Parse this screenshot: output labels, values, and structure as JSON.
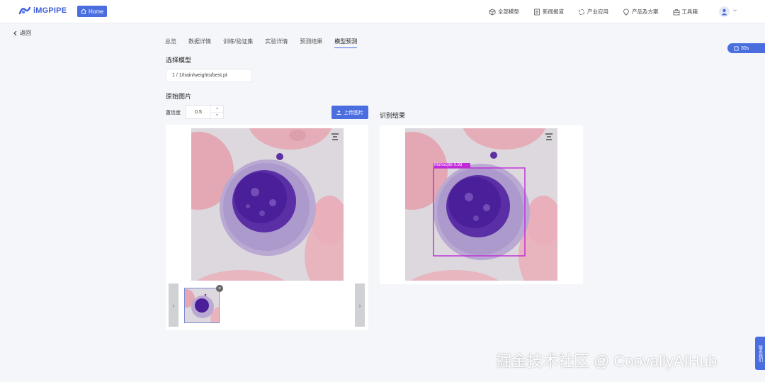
{
  "header": {
    "logo_text": "iMGPIPE",
    "home_label": "Home",
    "nav": [
      {
        "label": "全部模型",
        "icon": "cube-icon"
      },
      {
        "label": "新闻报道",
        "icon": "document-icon"
      },
      {
        "label": "产业应用",
        "icon": "cycle-icon"
      },
      {
        "label": "产品及方案",
        "icon": "bulb-icon"
      },
      {
        "label": "工具箱",
        "icon": "toolbox-icon"
      }
    ]
  },
  "back_label": "返回",
  "tabs": [
    "总览",
    "数据详情",
    "训练/验证集",
    "实验详情",
    "预测结果",
    "模型预测"
  ],
  "active_tab_index": 5,
  "timer_label": "30s",
  "model": {
    "section_label": "选择模型",
    "selected": "1 / 1/train/weights/best.pt"
  },
  "original": {
    "section_label": "原始图片",
    "confidence_label": "置信度",
    "confidence_value": "0.5",
    "upload_label": "上传图片"
  },
  "result": {
    "section_label": "识别结果",
    "detection_label": "Monocyte  0.93"
  },
  "side_tab_label": "联系我们",
  "watermark": "掘金技术社区 @ CoovallyAIHub",
  "colors": {
    "accent": "#4a6ee0",
    "bbox": "#c02ad8"
  }
}
